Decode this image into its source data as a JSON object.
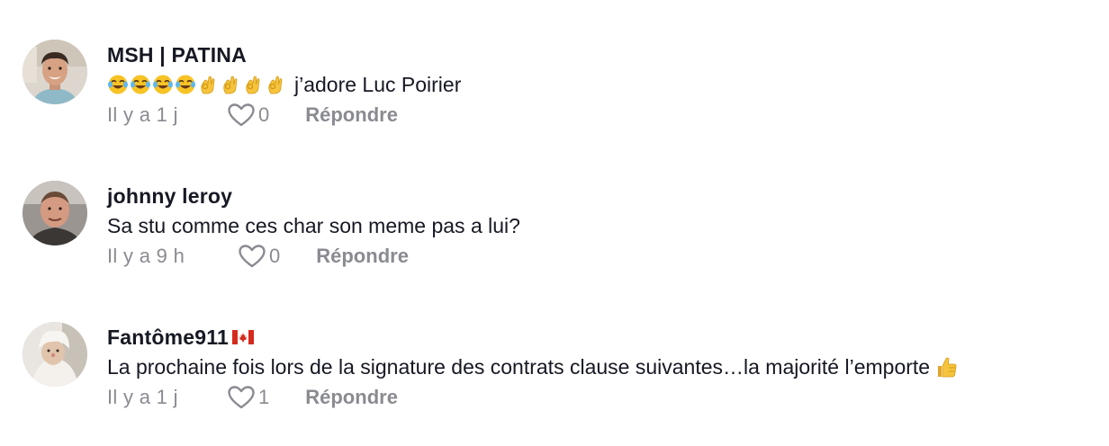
{
  "comments": [
    {
      "username": "MSH | PATINA",
      "text": "j’adore Luc Poirier",
      "emojis": [
        "laughing-tears",
        "laughing-tears",
        "laughing-tears",
        "laughing-tears",
        "ok-hand",
        "ok-hand",
        "ok-hand",
        "ok-hand"
      ],
      "time": "Il y a 1 j",
      "likes": "0",
      "reply_label": "Répondre"
    },
    {
      "username": "johnny leroy",
      "text": "Sa stu comme ces char son meme pas a lui?",
      "time": "Il y a 9 h",
      "likes": "0",
      "reply_label": "Répondre"
    },
    {
      "username": "Fantôme911",
      "username_badge": "canada-flag",
      "text": "La prochaine fois lors de la signature des contrats clause suivantes…la majorité l’emporte",
      "trailing_emoji": "thumbs-up",
      "time": "Il y a 1 j",
      "likes": "1",
      "reply_label": "Répondre"
    }
  ],
  "colors": {
    "primary_text": "#161823",
    "secondary_text": "#8a8b91"
  }
}
